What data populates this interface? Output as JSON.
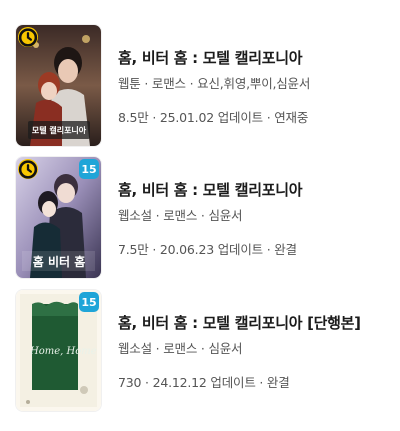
{
  "items": [
    {
      "title": "홈, 비터 홈 : 모텔 캘리포니아",
      "meta": "웹툰 · 로맨스 · 요신,휘영,뿌이,심윤서",
      "stats": "8.5만 · 25.01.02 업데이트 · 연재중",
      "badges": {
        "wait_free": true,
        "age": ""
      },
      "cover_text": "모텔 캘리포니아"
    },
    {
      "title": "홈, 비터 홈 : 모텔 캘리포니아",
      "meta": "웹소설 · 로맨스 · 심윤서",
      "stats": "7.5만 · 20.06.23 업데이트 · 완결",
      "badges": {
        "wait_free": true,
        "age": "15"
      },
      "cover_text": "홈 비터 홈"
    },
    {
      "title": "홈, 비터 홈 : 모텔 캘리포니아 [단행본]",
      "meta": "웹소설 · 로맨스 · 심윤서",
      "stats": "730 · 24.12.12 업데이트 · 완결",
      "badges": {
        "wait_free": false,
        "age": "15"
      },
      "cover_text": "Home, Home"
    }
  ]
}
